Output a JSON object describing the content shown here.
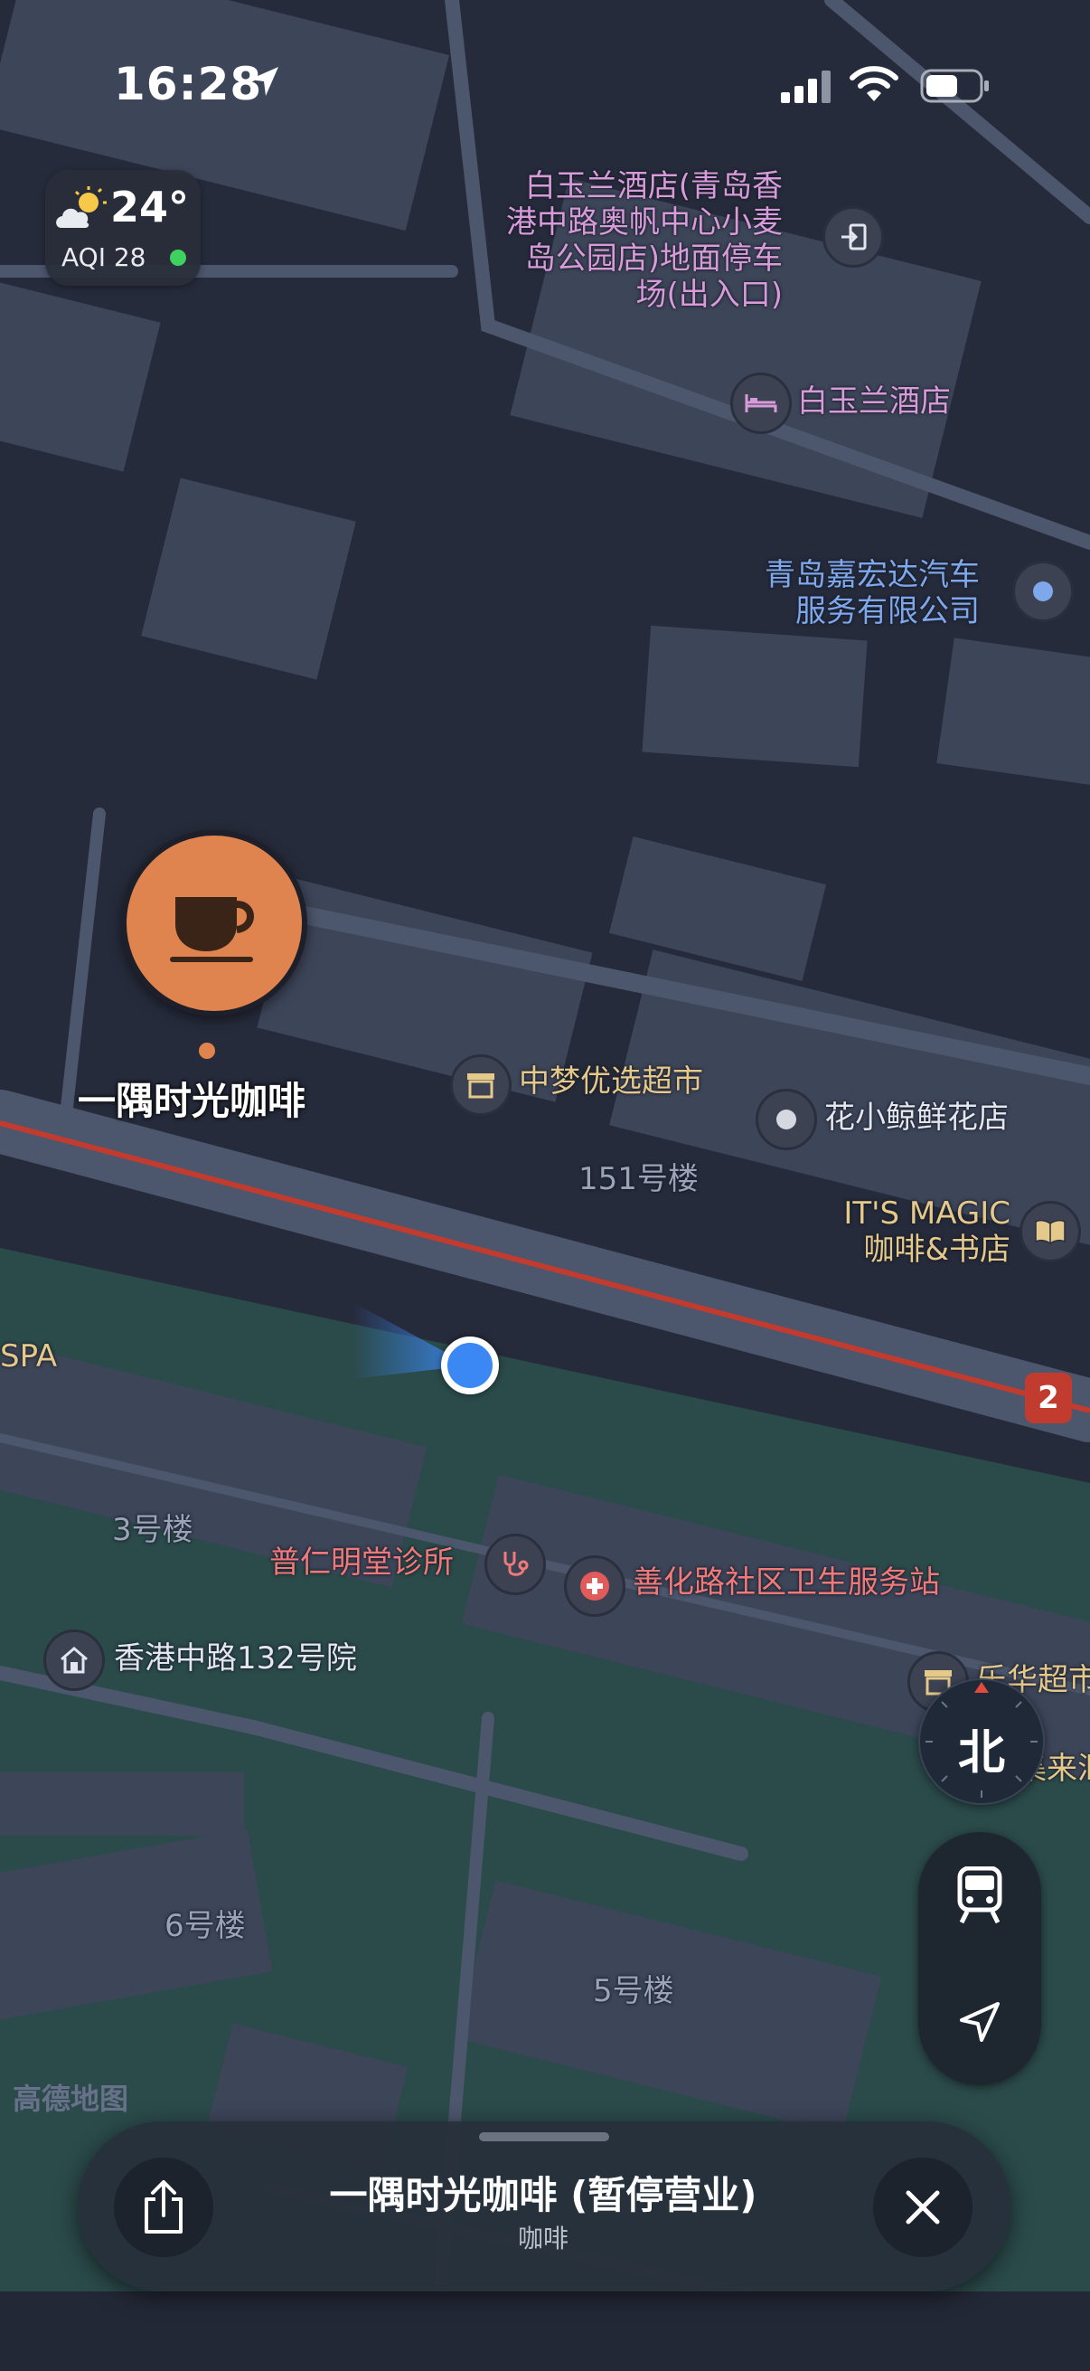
{
  "status_bar": {
    "time": "16:28",
    "icons": [
      "location-arrow-icon",
      "cellular-signal-icon",
      "wifi-icon",
      "battery-icon"
    ]
  },
  "weather": {
    "temperature": "24°",
    "aqi": "AQI 28",
    "icon": "partly-sunny-icon",
    "aqi_color": "#3ed160"
  },
  "map": {
    "attribution": "高德地图",
    "route_badge": "2",
    "route_color": "#c23b2f",
    "pois": [
      {
        "label": "白玉兰酒店(青岛香港中路奥帆中心小麦岛公园店)地面停车场(出入口)",
        "lines": [
          "白玉兰酒店(青岛香",
          "港中路奥帆中心小麦",
          "岛公园店)地面停车",
          "场(出入口)"
        ],
        "icon": "entrance-icon"
      },
      {
        "label": "白玉兰酒店",
        "icon": "hotel-bed-icon"
      },
      {
        "label": "青岛嘉宏达汽车服务有限公司",
        "lines": [
          "青岛嘉宏达汽车",
          "服务有限公司"
        ],
        "icon": "dot-icon"
      },
      {
        "label": "中梦优选超市",
        "icon": "store-icon"
      },
      {
        "label": "花小鲸鲜花店",
        "icon": "dot-icon"
      },
      {
        "label": "151号楼"
      },
      {
        "label": "IT'S MAGIC 咖啡&书店",
        "lines": [
          "IT'S MAGIC",
          "咖啡&书店"
        ],
        "icon": "book-icon"
      },
      {
        "label": "SPA"
      },
      {
        "label": "3号楼"
      },
      {
        "label": "普仁明堂诊所",
        "icon": "stethoscope-icon"
      },
      {
        "label": "善化路社区卫生服务站",
        "icon": "medical-cross-icon"
      },
      {
        "label": "香港中路132号院",
        "icon": "house-icon"
      },
      {
        "label": "乐华超市",
        "icon": "store-icon"
      },
      {
        "label": "集来汇"
      },
      {
        "label": "6号楼"
      },
      {
        "label": "5号楼"
      }
    ],
    "selected_pin": {
      "label": "一隅时光咖啡",
      "icon": "coffee-cup-icon",
      "color": "#e0844f"
    }
  },
  "controls": {
    "compass": "北",
    "transit_icon": "train-icon",
    "locate_icon": "location-arrow-icon"
  },
  "place_card": {
    "title": "一隅时光咖啡 (暂停营业)",
    "category": "咖啡",
    "share_icon": "share-icon",
    "close_icon": "close-icon"
  }
}
